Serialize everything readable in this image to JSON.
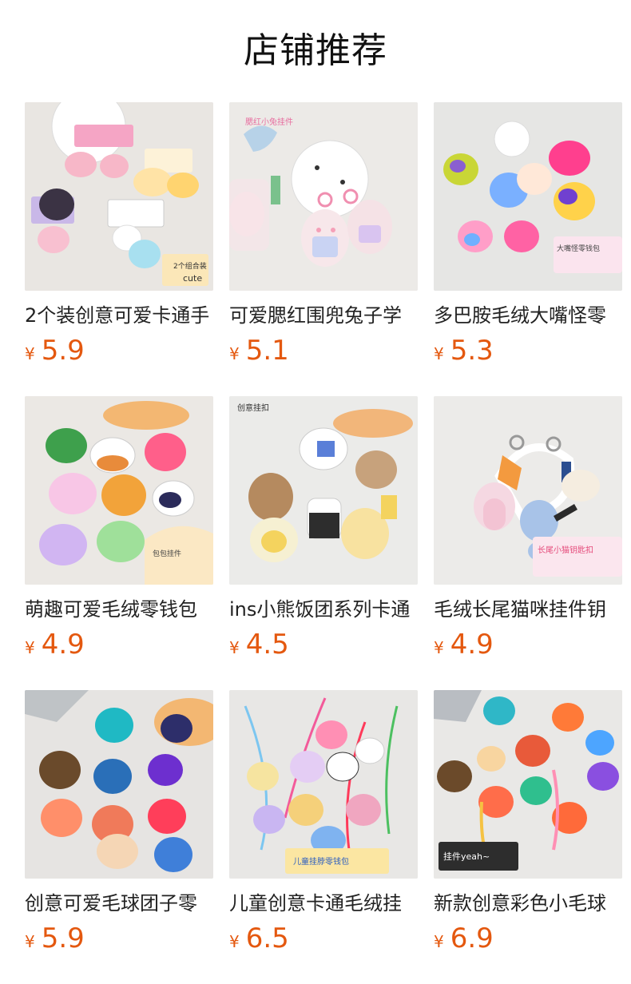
{
  "header": {
    "title": "店铺推荐"
  },
  "products": [
    {
      "name": "2个装创意可爱卡通手",
      "currency": "¥",
      "price": "5.9",
      "bg": "#e9e6e2",
      "image_text": [
        "2个组合装",
        "cute"
      ]
    },
    {
      "name": "可爱腮红围兜兔子学",
      "currency": "¥",
      "price": "5.1",
      "bg": "#eceae7",
      "image_text": [
        "腮红小兔挂件"
      ]
    },
    {
      "name": "多巴胺毛绒大嘴怪零",
      "currency": "¥",
      "price": "5.3",
      "bg": "#e6e6e4",
      "image_text": [
        "大嘴怪零钱包"
      ]
    },
    {
      "name": "萌趣可爱毛绒零钱包",
      "currency": "¥",
      "price": "4.9",
      "bg": "#ebe8e4",
      "image_text": [
        "包包挂件"
      ]
    },
    {
      "name": "ins小熊饭团系列卡通",
      "currency": "¥",
      "price": "4.5",
      "bg": "#ebebe9",
      "image_text": [
        "创意挂扣"
      ]
    },
    {
      "name": "毛绒长尾猫咪挂件钥",
      "currency": "¥",
      "price": "4.9",
      "bg": "#ecebe9",
      "image_text": [
        "长尾小猫钥匙扣"
      ]
    },
    {
      "name": "创意可爱毛球团子零",
      "currency": "¥",
      "price": "5.9",
      "bg": "#e6e4e2",
      "image_text": []
    },
    {
      "name": "儿童创意卡通毛绒挂",
      "currency": "¥",
      "price": "6.5",
      "bg": "#e8e7e5",
      "image_text": [
        "儿童挂脖零钱包"
      ]
    },
    {
      "name": "新款创意彩色小毛球",
      "currency": "¥",
      "price": "6.9",
      "bg": "#e9e8e6",
      "image_text": [
        "挂件yeah~"
      ]
    }
  ],
  "colors": {
    "price": "#e4580f",
    "title": "#111111",
    "name": "#222222"
  }
}
